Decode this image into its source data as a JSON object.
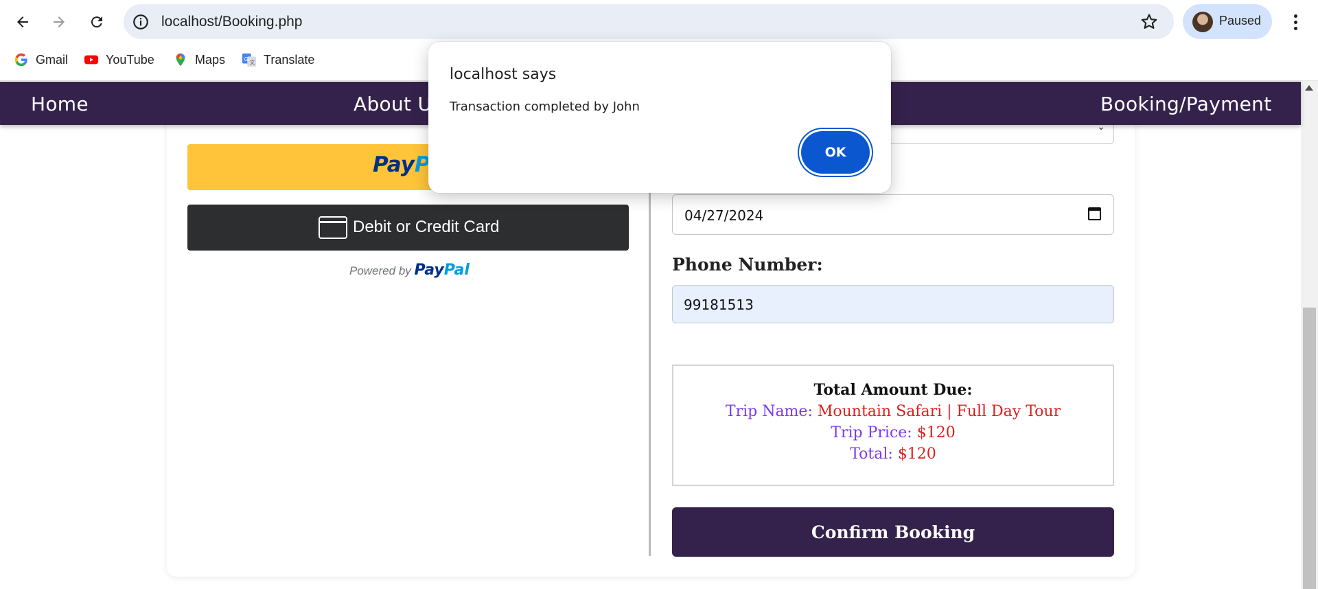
{
  "browser": {
    "url": "localhost/Booking.php",
    "profile_status": "Paused",
    "bookmarks": [
      "Gmail",
      "YouTube",
      "Maps",
      "Translate"
    ]
  },
  "site_nav": {
    "items": [
      "Home",
      "About U",
      "Booking/Payment"
    ]
  },
  "payment": {
    "paypal_part1": "Pay",
    "paypal_part2": "Pa",
    "card_label": "Debit or Credit Card",
    "powered_by": "Powered by",
    "powered_brand1": "Pay",
    "powered_brand2": "Pal"
  },
  "form": {
    "date_value": "04/27/2024",
    "phone_label": "Phone Number:",
    "phone_value": "99181513"
  },
  "summary": {
    "title": "Total Amount Due:",
    "trip_name_label": "Trip Name:",
    "trip_name_value": "Mountain Safari | Full Day Tour",
    "trip_price_label": "Trip Price:",
    "trip_price_value": "$120",
    "total_label": "Total:",
    "total_value": "$120"
  },
  "confirm_label": "Confirm Booking",
  "dialog": {
    "title": "localhost says",
    "message": "Transaction completed by John",
    "ok_label": "OK"
  },
  "colors": {
    "nav_bg": "#35224c",
    "paypal_yellow": "#ffc439",
    "card_dark": "#2c2e2f",
    "label_purple": "#7c3aed",
    "value_red": "#e11d1d",
    "dialog_button": "#0b57d0"
  }
}
